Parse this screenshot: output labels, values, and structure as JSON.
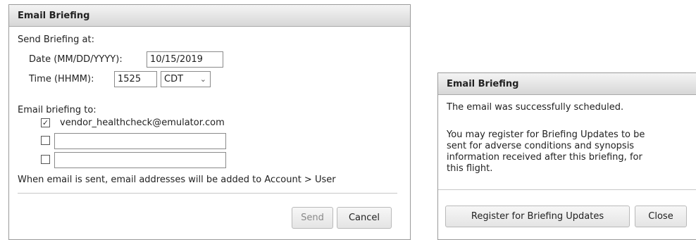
{
  "schedule_dialog": {
    "title": "Email Briefing",
    "send_at_label": "Send Briefing at:",
    "date_label": "Date (MM/DD/YYYY):",
    "date_value": "10/15/2019",
    "time_label": "Time (HHMM):",
    "time_value": "1525",
    "timezone_value": "CDT",
    "email_to_label": "Email briefing to:",
    "recipients": [
      {
        "checked": true,
        "text": "vendor_healthcheck@emulator.com"
      },
      {
        "checked": false,
        "value": ""
      },
      {
        "checked": false,
        "value": ""
      }
    ],
    "notice": "When email is sent, email addresses will be added to Account > User",
    "send_label": "Send",
    "cancel_label": "Cancel"
  },
  "confirm_dialog": {
    "title": "Email Briefing",
    "success_message": "The email was successfully scheduled.",
    "info_lines": [
      "You may register for Briefing Updates to be",
      "sent for adverse conditions and synopsis",
      "information received after this briefing, for",
      "this flight."
    ],
    "register_label": "Register for Briefing Updates",
    "close_label": "Close"
  },
  "icons": {
    "checkbox_check": "check-icon",
    "select_caret": "chevron-down-icon"
  }
}
